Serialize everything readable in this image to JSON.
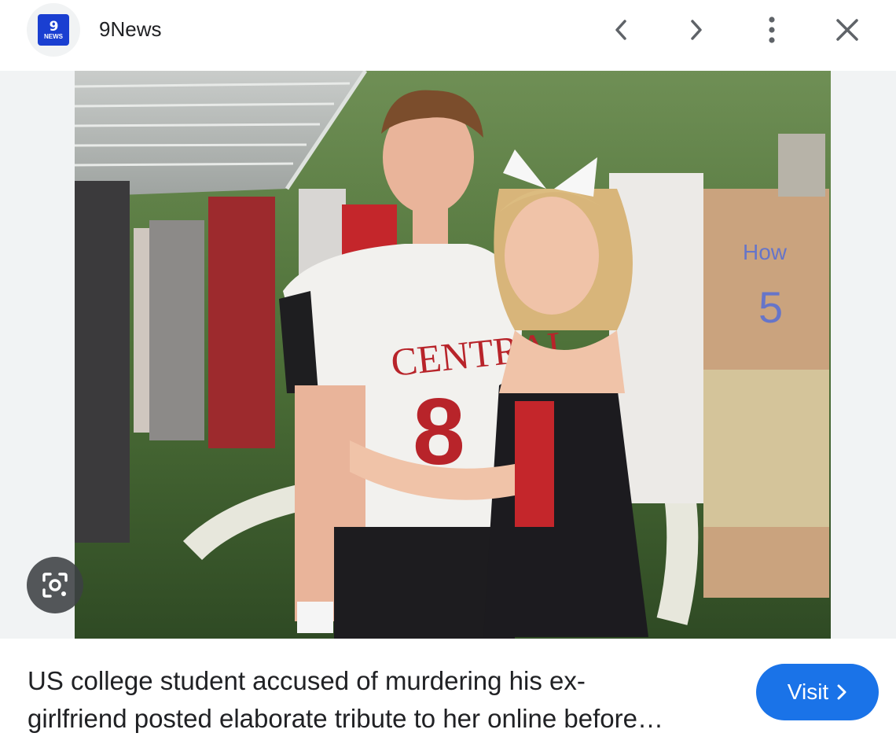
{
  "header": {
    "source_logo_number": "9",
    "source_logo_text": "NEWS",
    "source_name": "9News",
    "prev_icon": "chevron-left-icon",
    "next_icon": "chevron-right-icon",
    "more_icon": "more-vert-icon",
    "close_icon": "close-icon"
  },
  "image": {
    "lens_icon": "visual-search-icon",
    "jersey_text": "CENTRAL",
    "jersey_number": "8",
    "body_paint_word": "How",
    "body_paint_number": "5"
  },
  "caption": {
    "line1": "US college student accused of murdering his ex-",
    "line2": "girlfriend posted elaborate tribute to her online before…"
  },
  "visit": {
    "label": "Visit",
    "icon": "chevron-right-icon"
  },
  "colors": {
    "accent": "#1a73e8",
    "logo_blue": "#1a3fd1"
  }
}
